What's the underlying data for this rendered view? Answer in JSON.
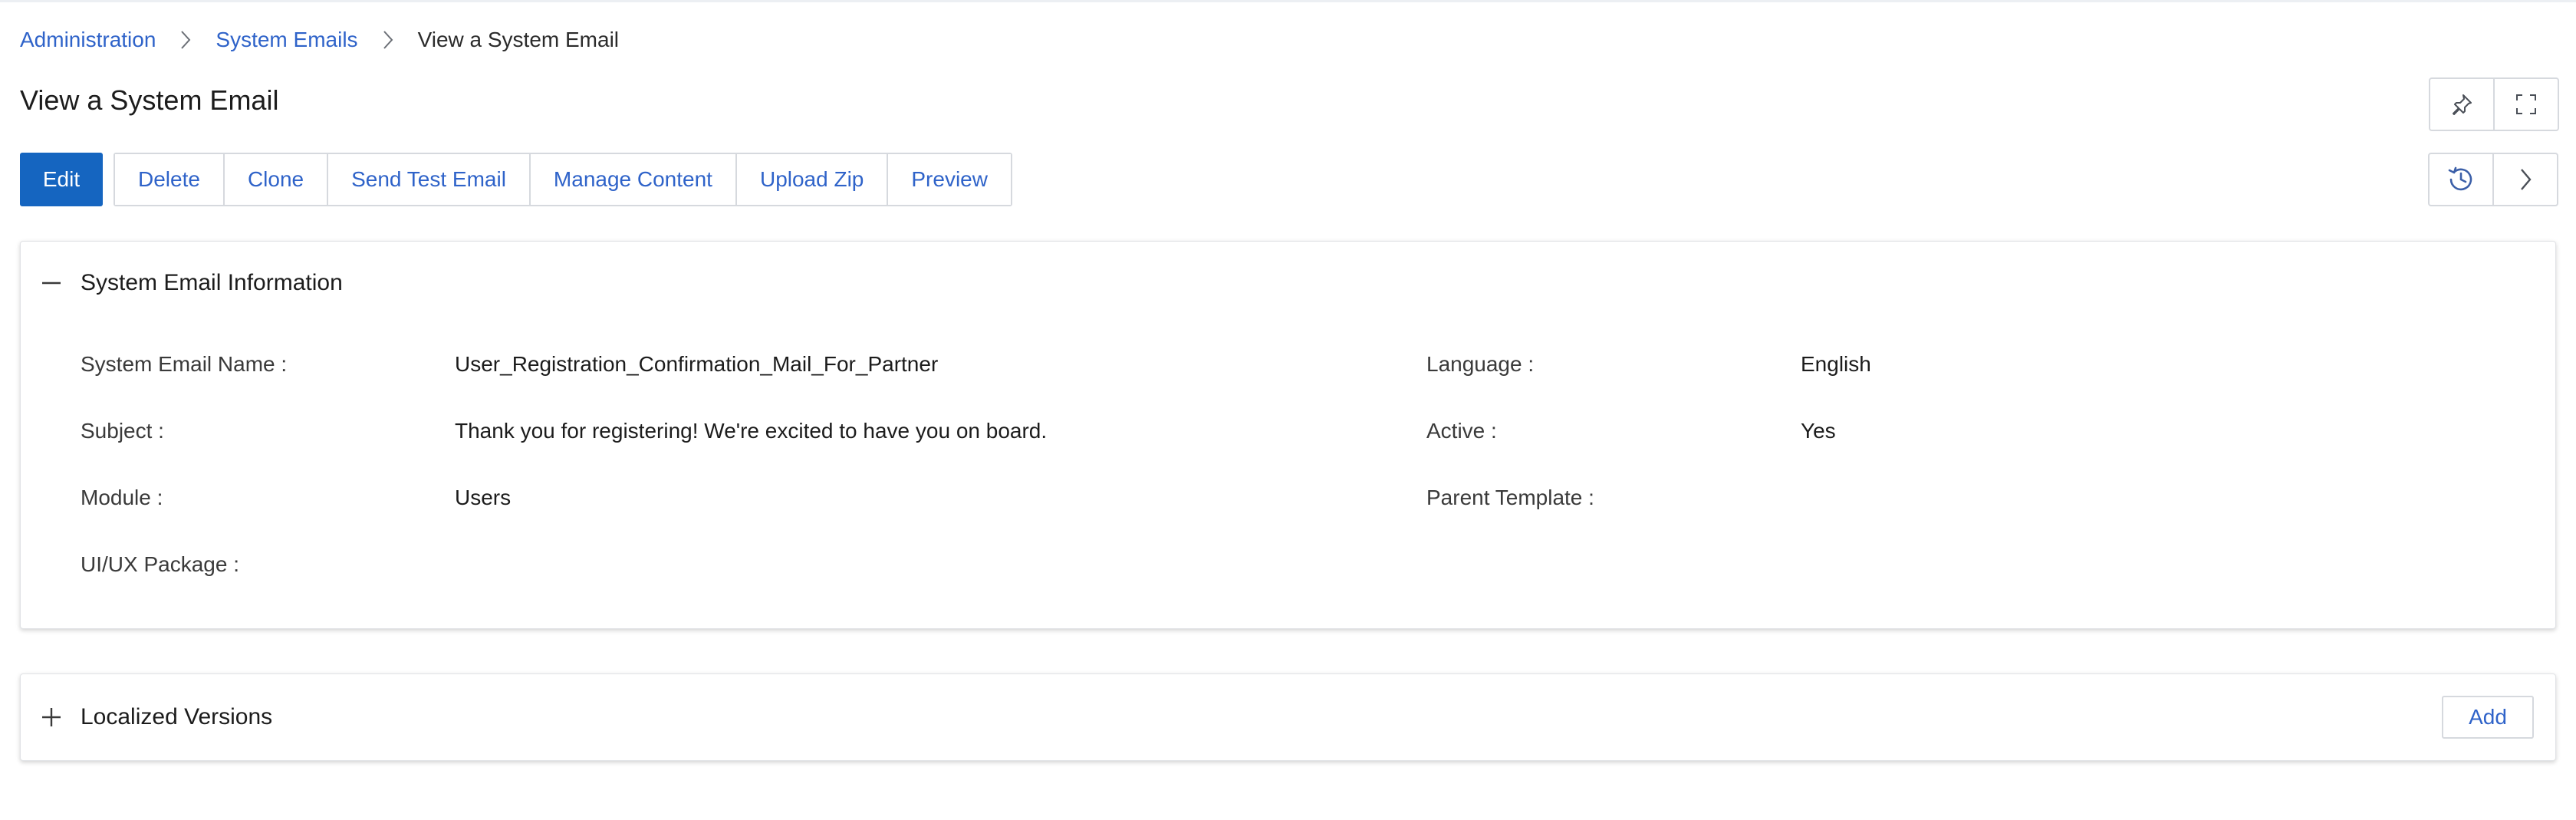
{
  "breadcrumb": {
    "items": [
      {
        "label": "Administration"
      },
      {
        "label": "System Emails"
      },
      {
        "label": "View a System Email"
      }
    ]
  },
  "page": {
    "title": "View a System Email"
  },
  "toolbar": {
    "edit_label": "Edit",
    "buttons": [
      {
        "label": "Delete"
      },
      {
        "label": "Clone"
      },
      {
        "label": "Send Test Email"
      },
      {
        "label": "Manage Content"
      },
      {
        "label": "Upload Zip"
      },
      {
        "label": "Preview"
      }
    ]
  },
  "header_icons": {
    "top": [
      "pin-icon",
      "fullscreen-icon"
    ],
    "mid": [
      "history-icon",
      "chevron-right-icon"
    ]
  },
  "info_panel": {
    "title": "System Email Information",
    "toggle_icon": "collapse-minus-icon",
    "fields": {
      "name": {
        "label": "System Email Name :",
        "value": "User_Registration_Confirmation_Mail_For_Partner"
      },
      "language": {
        "label": "Language :",
        "value": "English"
      },
      "subject": {
        "label": "Subject :",
        "value": "Thank you for registering! We're excited to have you on board."
      },
      "active": {
        "label": "Active :",
        "value": "Yes"
      },
      "module": {
        "label": "Module :",
        "value": "Users"
      },
      "parent_template": {
        "label": "Parent Template :",
        "value": ""
      },
      "uiux_package": {
        "label": "UI/UX Package :",
        "value": ""
      }
    }
  },
  "localized_panel": {
    "title": "Localized Versions",
    "toggle_icon": "expand-plus-icon",
    "add_label": "Add"
  },
  "colors": {
    "link": "#2f63c9",
    "primary_button": "#1565c0",
    "border": "#d6d9de"
  }
}
